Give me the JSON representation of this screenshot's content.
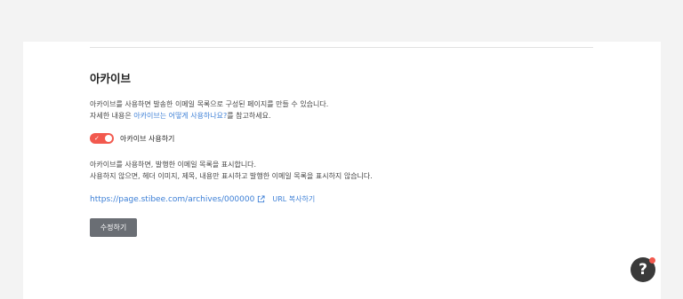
{
  "section": {
    "title": "아카이브",
    "description_line1": "아카이브를 사용하면 발송한 이메일 목록으로 구성된 페이지를 만들 수 있습니다.",
    "description_line2_prefix": "자세한 내용은 ",
    "description_link": "아카이브는 어떻게 사용하나요?",
    "description_line2_suffix": "를 참고하세요."
  },
  "toggle": {
    "label": "아카이브 사용하기",
    "enabled": true,
    "check_glyph": "✓"
  },
  "info": {
    "line1": "아카이브를 사용하면, 발행한 이메일 목록을 표시합니다.",
    "line2": "사용하지 않으면, 헤더 이미지, 제목, 내용만 표시하고 발행한 이메일 목록을 표시하지 않습니다."
  },
  "archive": {
    "url": "https://page.stibee.com/archives/000000",
    "copy_label": "URL 복사하기",
    "icon": "external-link-icon"
  },
  "edit_button": {
    "label": "수정하기"
  },
  "help": {
    "glyph": "?",
    "icon": "help-icon"
  },
  "colors": {
    "accent_red": "#f2594e",
    "link_blue": "#3c7fd6",
    "button_gray": "#6a6e74",
    "help_dark": "#3a3a3a"
  }
}
